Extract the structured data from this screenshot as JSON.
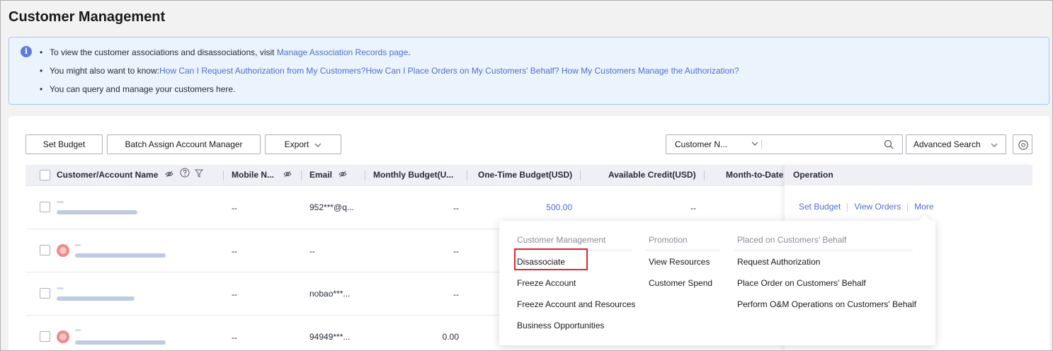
{
  "page": {
    "title": "Customer Management"
  },
  "notice": {
    "line1_prefix": "To view the customer associations and disassociations, visit ",
    "line1_link": "Manage Association Records page",
    "line1_suffix": ".",
    "line2_prefix": "You might also want to know:",
    "line2_link1": "How Can I Request Authorization from My Customers?",
    "line2_link2": "How Can I Place Orders on My Customers' Behalf?",
    "line2_link3": " How My Customers Manage the Authorization?",
    "line3": "You can query and manage your customers here."
  },
  "toolbar": {
    "set_budget": "Set Budget",
    "batch_assign": "Batch Assign Account Manager",
    "export": "Export",
    "search_field": "Customer N...",
    "search_placeholder": "",
    "advanced_search": "Advanced Search"
  },
  "table": {
    "columns": {
      "name": "Customer/Account Name",
      "mobile": "Mobile N...",
      "email": "Email",
      "monthly_budget": "Monthly Budget(U...",
      "one_time_budget": "One-Time Budget(USD)",
      "available_credit": "Available Credit(USD)",
      "month_to_date": "Month-to-Date",
      "operation": "Operation"
    },
    "rows": [
      {
        "mobile": "--",
        "email": "952***@q...",
        "monthly_budget": "--",
        "one_time_budget": "500.00",
        "available_credit": "--"
      },
      {
        "mobile": "--",
        "email": "--",
        "monthly_budget": "--",
        "one_time_budget": "",
        "available_credit": ""
      },
      {
        "mobile": "--",
        "email": "nobao***...",
        "monthly_budget": "--",
        "one_time_budget": "",
        "available_credit": ""
      },
      {
        "mobile": "--",
        "email": "94949***...",
        "monthly_budget": "0.00",
        "one_time_budget": "",
        "available_credit": ""
      }
    ]
  },
  "operation": {
    "set_budget": "Set Budget",
    "view_orders": "View Orders",
    "more": "More"
  },
  "more_menu": {
    "groups": [
      {
        "title": "Customer Management",
        "items": [
          "Disassociate",
          "Freeze Account",
          "Freeze Account and Resources",
          "Business Opportunities"
        ]
      },
      {
        "title": "Promotion",
        "items": [
          "View Resources",
          "Customer Spend"
        ]
      },
      {
        "title": "Placed on Customers' Behalf",
        "items": [
          "Request Authorization",
          "Place Order on Customers' Behalf",
          "Perform O&M Operations on Customers' Behalf"
        ]
      }
    ]
  },
  "colors": {
    "accent": "#526ecc",
    "notice_bg": "#ebf3fd",
    "highlight": "#e0262b"
  }
}
